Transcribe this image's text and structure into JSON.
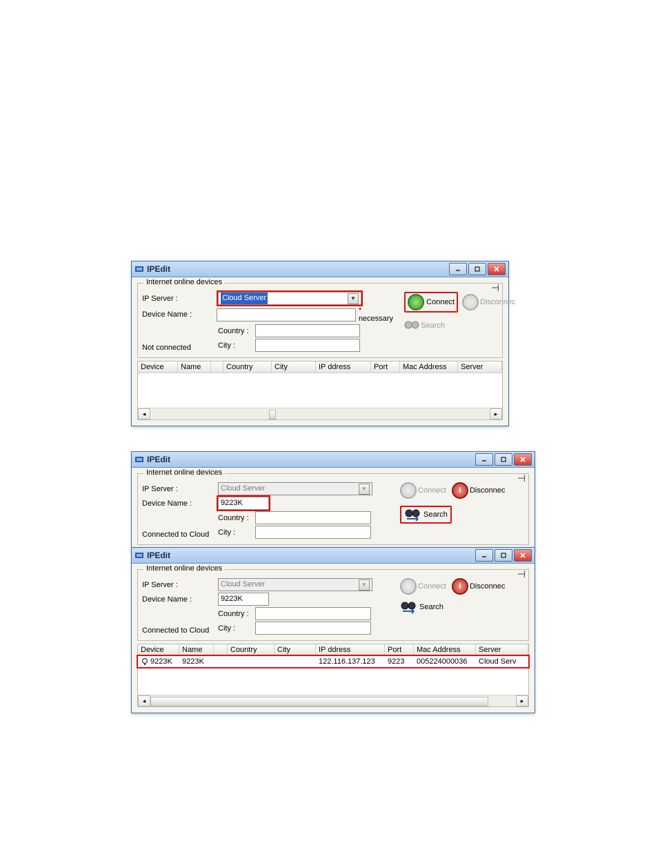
{
  "app": {
    "title": "IPEdit"
  },
  "group": {
    "label": "Internet online devices"
  },
  "labels": {
    "ip_server": "IP Server :",
    "device_name": "Device Name :",
    "country": "Country :",
    "city": "City :",
    "necessary": "* necessary",
    "connect": "Connect",
    "disconnect": "Disconnec",
    "search": "Search",
    "not_connected": "Not connected",
    "connected": "Connected to Cloud"
  },
  "columns": {
    "device": "Device",
    "name": "Name",
    "country": "Country",
    "city": "City",
    "ip": "IP ddress",
    "port": "Port",
    "mac": "Mac Address",
    "server": "Server"
  },
  "win1": {
    "ip_server_value": "Cloud Server",
    "device_name_value": "",
    "country_value": "",
    "city_value": ""
  },
  "win2": {
    "ip_server_value": "Cloud Server",
    "device_name_value": "9223K",
    "country_value": "",
    "city_value": ""
  },
  "win3": {
    "ip_server_value": "Cloud Server",
    "device_name_value": "9223K",
    "country_value": "",
    "city_value": "",
    "result": {
      "device": "9223K",
      "name": "9223K",
      "country": "",
      "city": "",
      "ip": "122.116.137.123",
      "port": "9223",
      "mac": "005224000036",
      "server": "Cloud Serv"
    }
  }
}
